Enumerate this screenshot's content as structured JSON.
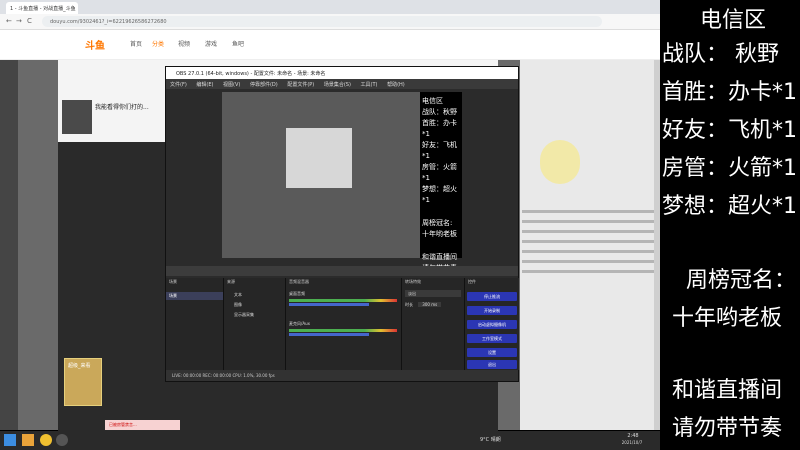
{
  "browser": {
    "tab_title": "1 - 斗鱼直播 - 对战直播_斗鱼",
    "address": "douyu.com/9302461?_i=62219626586272680",
    "nav_back": "←",
    "nav_forward": "→",
    "nav_reload": "C"
  },
  "site": {
    "logo": "斗鱼",
    "nav": [
      "首页",
      "分类",
      "视频",
      "游戏",
      "鱼吧"
    ],
    "room_title": "我能看得你们打的...",
    "gift_label": "超级_来看",
    "toast": "已被房管禁言..."
  },
  "obs": {
    "title": "OBS 27.0.1 (64-bit, windows) - 配置文件: 未命名 - 场景: 未命名",
    "menu": [
      "文件(F)",
      "编辑(E)",
      "视图(V)",
      "停靠部件(D)",
      "配置文件(P)",
      "场景集合(S)",
      "工具(T)",
      "帮助(H)"
    ],
    "docks": {
      "scenes": "场景",
      "sources": "来源",
      "mixer": "音频混音器",
      "transitions": "转场特效",
      "controls": "控件"
    },
    "scene_item": "场景",
    "source_items": [
      "文本",
      "图像",
      "显示器采集"
    ],
    "mixer_items": [
      "桌面音频",
      "麦克风/Aux"
    ],
    "transition_value": "淡出",
    "duration_label": "时长",
    "duration_value": "300 ms",
    "control_buttons": [
      "停止推流",
      "开始录制",
      "启动虚拟摄像机",
      "工作室模式",
      "设置",
      "退出"
    ],
    "status": "LIVE: 00:00:00   REC: 00:00:00   CPU: 1.0%, 30.00 fps",
    "mini_overlay": [
      "电信区",
      "战队：秋野",
      "首胜：办卡*1",
      "好友：飞机*1",
      "房管：火箭*1",
      "梦想：超火*1",
      "周榜冠名:",
      "十年哟老板",
      "和谐直播间",
      "请勿带节奏"
    ]
  },
  "taskbar": {
    "time": "2:48",
    "date": "2021/10/7",
    "weather": "9°C 晴朗"
  },
  "overlay": {
    "region": "电信区",
    "team": "战队：  秋野",
    "first_win": "首胜：办卡*1",
    "friend": "好友：飞机*1",
    "admin": "房管：火箭*1",
    "dream": "梦想：超火*1",
    "weekly_title": "周榜冠名：",
    "weekly_sponsor": "十年哟老板",
    "notice1": "和谐直播间",
    "notice2": "请勿带节奏"
  },
  "colors": {
    "douyu_orange": "#ff7700",
    "obs_button_blue": "#2b36b4",
    "overlay_bg": "#000000",
    "overlay_text": "#ffffff"
  }
}
